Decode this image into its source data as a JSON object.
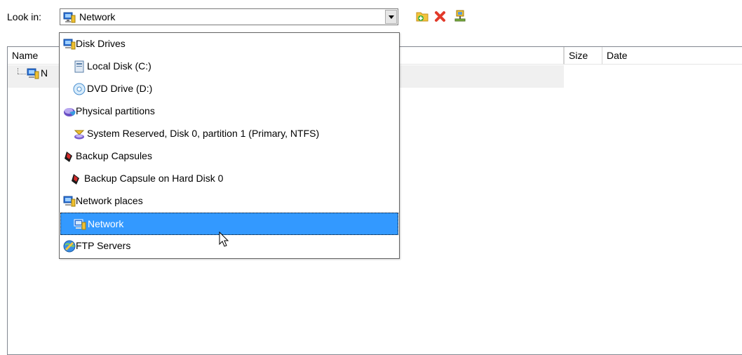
{
  "look_in": {
    "label": "Look in:",
    "value": "Network"
  },
  "toolbar": {
    "icons": [
      "new-folder-icon",
      "delete-icon",
      "network-drive-icon"
    ]
  },
  "file_list": {
    "columns": [
      "Name",
      "Size",
      "Date"
    ],
    "tree_item": "N"
  },
  "dropdown": {
    "items": [
      {
        "label": "Disk Drives",
        "icon": "network-computer-icon"
      },
      {
        "label": "Local Disk (C:)",
        "icon": "local-disk-icon"
      },
      {
        "label": "DVD Drive (D:)",
        "icon": "dvd-drive-icon"
      },
      {
        "label": "Physical partitions",
        "icon": "partition-icon"
      },
      {
        "label": "System Reserved, Disk 0, partition 1 (Primary, NTFS)",
        "icon": "partition-volume-icon"
      },
      {
        "label": "Backup Capsules",
        "icon": "backup-capsule-icon"
      },
      {
        "label": "Backup Capsule on Hard Disk 0",
        "icon": "backup-capsule-icon"
      },
      {
        "label": "Network places",
        "icon": "network-computer-icon"
      },
      {
        "label": "Network",
        "icon": "network-computer-icon",
        "selected": true
      },
      {
        "label": "FTP Servers",
        "icon": "ftp-globe-icon"
      }
    ]
  },
  "colors": {
    "selection": "#3399ff",
    "border": "#7a7a7a"
  }
}
